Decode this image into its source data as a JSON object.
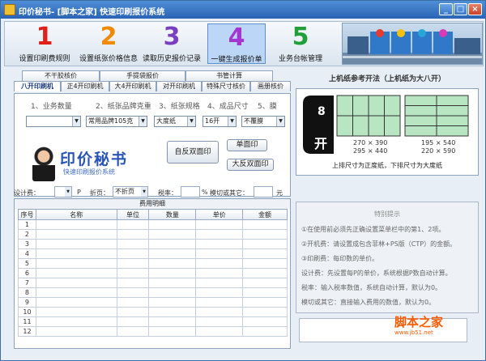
{
  "window": {
    "title": "印价秘书- [脚本之家] 快速印刷报价系统",
    "btn_min": "_",
    "btn_max": "□",
    "btn_close": "×"
  },
  "toolbar": {
    "items": [
      {
        "num": "1",
        "label": "设置印刷费规则",
        "color": "#e0201a"
      },
      {
        "num": "2",
        "label": "设置纸张价格信息",
        "color": "#f08a00"
      },
      {
        "num": "3",
        "label": "读取历史报价记录",
        "color": "#7a3fc0"
      },
      {
        "num": "4",
        "label": "一键生成报价单",
        "color": "#a535d0"
      },
      {
        "num": "5",
        "label": "业务台帐管理",
        "color": "#21a03a"
      }
    ]
  },
  "tabs": {
    "row1": [
      "不干胶核价",
      "手提袋报价",
      "书管计算"
    ],
    "row2": [
      "八开印刷机",
      "正4开印刷机",
      "大4开印刷机",
      "对开印刷机",
      "特殊尺寸核价",
      "画册核价"
    ]
  },
  "form": {
    "labels": [
      "1、业务数量",
      "2、纸张品牌克重",
      "3、纸张规格",
      "4、成品尺寸",
      "5、膜"
    ],
    "qty": "",
    "paper": "常用品牌105克",
    "size": "大度纸",
    "finish": "16开",
    "film": "不覆膜"
  },
  "logo": {
    "brand": "印价秘书",
    "sub": "快速印刷报价系统"
  },
  "buttons": {
    "double": "自反双面印",
    "single": "单面印",
    "bigback": "大反双面印"
  },
  "bar": {
    "design_lbl": "设计费：",
    "p": "P",
    "fold_lbl": "折页：",
    "fold_val": "不折页",
    "tax_lbl": "税率：",
    "pct": "%",
    "cut_lbl": "模切或其它：",
    "yuan": "元"
  },
  "cost": {
    "title": "费用明细",
    "headers": [
      "序号",
      "名称",
      "单位",
      "数量",
      "单价",
      "金额"
    ],
    "rows": [
      "1",
      "2",
      "3",
      "4",
      "5",
      "6",
      "7",
      "8",
      "9",
      "10",
      "11",
      "12"
    ]
  },
  "ref": {
    "title": "上机纸参考开法（上机纸为大八开）",
    "num": "8",
    "kai": "开",
    "g1a": "270 × 390",
    "g1b": "295 × 440",
    "g2a": "195 × 540",
    "g2b": "220 × 590",
    "caption": "上排尺寸为正度纸，下排尺寸为大度纸"
  },
  "tips": {
    "head": "特别提示",
    "lines": [
      "①在使用前必须先正确设置菜单栏中的第1、2项。",
      "②开机费：请设置成包含菲林+PS版（CTP）的金额。",
      "③印刷费：每印数的单价。",
      "设计费：先设置每P的单价，系统根据P数自动计算。",
      "税率：输入税率数值，系统自动计算，默认为0。",
      "模切或其它：直接输入费用的数值，默认为0。"
    ]
  },
  "watermark": {
    "brand": "脚本之家",
    "url": "www.jb51.net"
  }
}
